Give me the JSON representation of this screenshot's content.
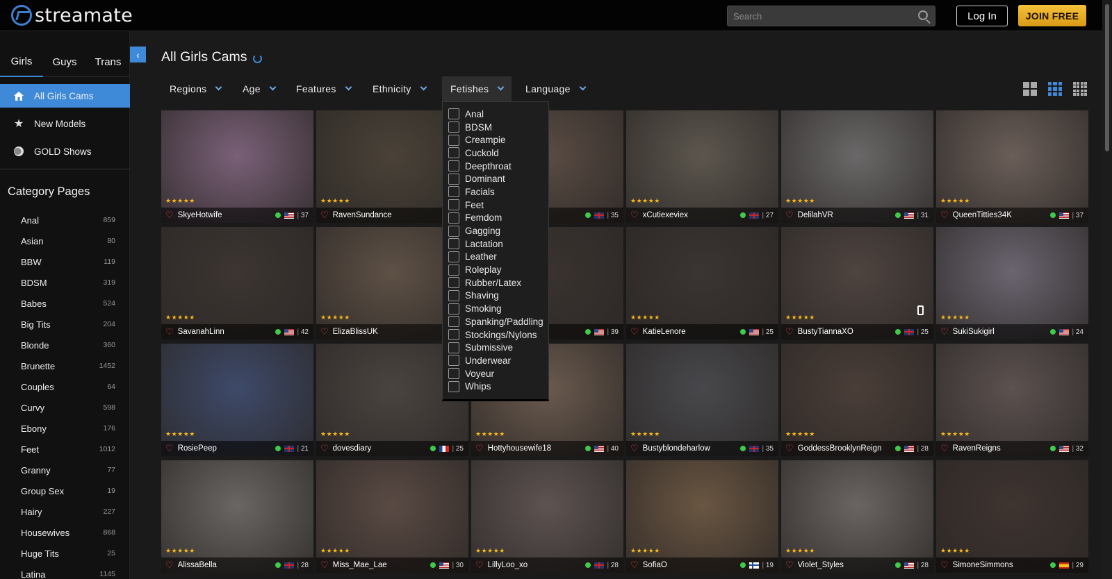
{
  "brand": {
    "name": "streamate",
    "accent": "#3f8ad8",
    "join_color": "#e8ad27"
  },
  "header": {
    "search_placeholder": "Search",
    "login_label": "Log In",
    "join_label": "JOIN FREE"
  },
  "sidebar": {
    "tabs": [
      {
        "label": "Girls",
        "active": true
      },
      {
        "label": "Guys",
        "active": false
      },
      {
        "label": "Trans",
        "active": false
      }
    ],
    "nav": [
      {
        "label": "All Girls Cams",
        "icon": "home-icon",
        "active": true
      },
      {
        "label": "New Models",
        "icon": "star-icon",
        "active": false
      },
      {
        "label": "GOLD Shows",
        "icon": "gold-coin-icon",
        "active": false
      }
    ],
    "category_title": "Category Pages",
    "categories": [
      {
        "name": "Anal",
        "count": "859"
      },
      {
        "name": "Asian",
        "count": "80"
      },
      {
        "name": "BBW",
        "count": "119"
      },
      {
        "name": "BDSM",
        "count": "319"
      },
      {
        "name": "Babes",
        "count": "524"
      },
      {
        "name": "Big Tits",
        "count": "204"
      },
      {
        "name": "Blonde",
        "count": "360"
      },
      {
        "name": "Brunette",
        "count": "1452"
      },
      {
        "name": "Couples",
        "count": "64"
      },
      {
        "name": "Curvy",
        "count": "598"
      },
      {
        "name": "Ebony",
        "count": "176"
      },
      {
        "name": "Feet",
        "count": "1012"
      },
      {
        "name": "Granny",
        "count": "77"
      },
      {
        "name": "Group Sex",
        "count": "19"
      },
      {
        "name": "Hairy",
        "count": "227"
      },
      {
        "name": "Housewives",
        "count": "868"
      },
      {
        "name": "Huge Tits",
        "count": "25"
      },
      {
        "name": "Latina",
        "count": "1145"
      }
    ]
  },
  "main": {
    "title": "All Girls Cams",
    "filters": [
      {
        "label": "Regions",
        "open": false
      },
      {
        "label": "Age",
        "open": false
      },
      {
        "label": "Features",
        "open": false
      },
      {
        "label": "Ethnicity",
        "open": false
      },
      {
        "label": "Fetishes",
        "open": true
      },
      {
        "label": "Language",
        "open": false
      }
    ],
    "fetish_options": [
      "Anal",
      "BDSM",
      "Creampie",
      "Cuckold",
      "Deepthroat",
      "Dominant",
      "Facials",
      "Feet",
      "Femdom",
      "Gagging",
      "Lactation",
      "Leather",
      "Roleplay",
      "Rubber/Latex",
      "Shaving",
      "Smoking",
      "Spanking/Paddling",
      "Stockings/Nylons",
      "Submissive",
      "Underwear",
      "Voyeur",
      "Whips"
    ],
    "rating_stars": "★★★★★",
    "models": [
      {
        "name": "SkyeHotwife",
        "flag": "us",
        "age": "37",
        "tint": "#7a6078"
      },
      {
        "name": "RavenSundance",
        "flag": "us",
        "age": "",
        "tint": "#4a4238"
      },
      {
        "name": "",
        "flag": "uk",
        "age": "35",
        "tint": "#5a4c44"
      },
      {
        "name": "xCutiexeviex",
        "flag": "uk",
        "age": "27",
        "tint": "#5c564e"
      },
      {
        "name": "DelilahVR",
        "flag": "us",
        "age": "31",
        "tint": "#6a6868"
      },
      {
        "name": "QueenTitties34K",
        "flag": "us",
        "age": "37",
        "tint": "#6a5e58"
      },
      {
        "name": "SavanahLinn",
        "flag": "us",
        "age": "42",
        "tint": "#3c3532"
      },
      {
        "name": "ElizaBlissUK",
        "flag": "uk",
        "age": "",
        "tint": "#5e5146"
      },
      {
        "name": "",
        "flag": "us",
        "age": "39",
        "tint": "#3a3330"
      },
      {
        "name": "KatieLenore",
        "flag": "us",
        "age": "25",
        "tint": "#3a3432"
      },
      {
        "name": "BustyTiannaXO",
        "flag": "uk",
        "age": "25",
        "tint": "#4e4440",
        "mobile": true
      },
      {
        "name": "SukiSukigirl",
        "flag": "us",
        "age": "24",
        "tint": "#6a6570"
      },
      {
        "name": "RosiePeep",
        "flag": "uk",
        "age": "21",
        "tint": "#3e4a6a"
      },
      {
        "name": "dovesdiary",
        "flag": "fr",
        "age": "25",
        "tint": "#4a4440"
      },
      {
        "name": "Hottyhousewife18",
        "flag": "us",
        "age": "40",
        "tint": "#6a5a4e"
      },
      {
        "name": "Bustyblondeharlow",
        "flag": "uk",
        "age": "35",
        "tint": "#48484c"
      },
      {
        "name": "GoddessBrooklynReign",
        "flag": "us",
        "age": "28",
        "tint": "#4a3e38"
      },
      {
        "name": "RavenReigns",
        "flag": "us",
        "age": "32",
        "tint": "#5c5250"
      },
      {
        "name": "AlissaBella",
        "flag": "uk",
        "age": "28",
        "tint": "#6a6664"
      },
      {
        "name": "Miss_Mae_Lae",
        "flag": "us",
        "age": "30",
        "tint": "#5a4a44"
      },
      {
        "name": "LillyLoo_xo",
        "flag": "uk",
        "age": "28",
        "tint": "#5e5452"
      },
      {
        "name": "SofiaO",
        "flag": "fi",
        "age": "19",
        "tint": "#6a5642"
      },
      {
        "name": "Violet_Styles",
        "flag": "us",
        "age": "28",
        "tint": "#6a6462"
      },
      {
        "name": "SimoneSimmons",
        "flag": "es",
        "age": "29",
        "tint": "#3e3430"
      }
    ]
  }
}
